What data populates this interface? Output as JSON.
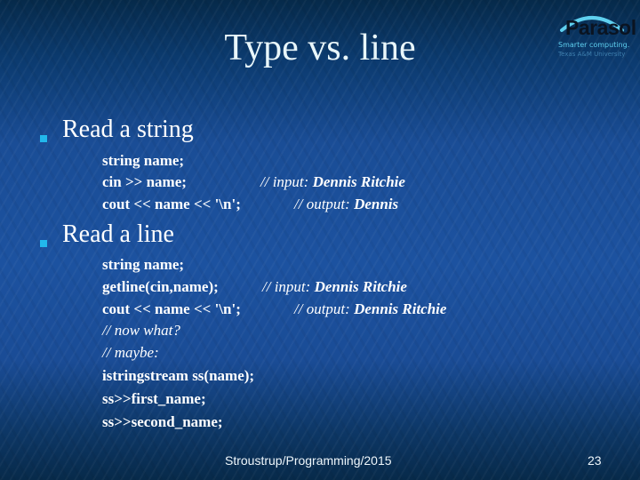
{
  "slide": {
    "title": "Type vs. line",
    "logo": {
      "name": "Parasol",
      "tagline": "Smarter computing.",
      "institution": "Texas A&M University"
    },
    "sections": [
      {
        "heading": "Read a string",
        "lines": [
          {
            "code": "string name;",
            "comment_prefix": "",
            "comment_value": ""
          },
          {
            "code": "cin >> name;",
            "comment_prefix": "// input: ",
            "comment_value": "Dennis Ritchie"
          },
          {
            "code": "cout << name << '\\n';",
            "comment_prefix": "// output: ",
            "comment_value": "Dennis"
          }
        ]
      },
      {
        "heading": "Read a line",
        "lines": [
          {
            "code": "string name;",
            "comment_prefix": "",
            "comment_value": ""
          },
          {
            "code": "getline(cin,name);",
            "comment_prefix": "// input: ",
            "comment_value": "Dennis Ritchie"
          },
          {
            "code": "cout << name << '\\n';",
            "comment_prefix": "// output: ",
            "comment_value": "Dennis Ritchie"
          }
        ],
        "extra_comments": [
          "// now what?",
          "// maybe:"
        ],
        "extra_code": [
          "istringstream ss(name);",
          "ss>>first_name;",
          "ss>>second_name;"
        ]
      }
    ],
    "footer": "Stroustrup/Programming/2015",
    "page_number": "23",
    "colors": {
      "bullet": "#22b8ec",
      "title": "#e8f6fa",
      "logo_accent": "#5fd0ef"
    }
  }
}
